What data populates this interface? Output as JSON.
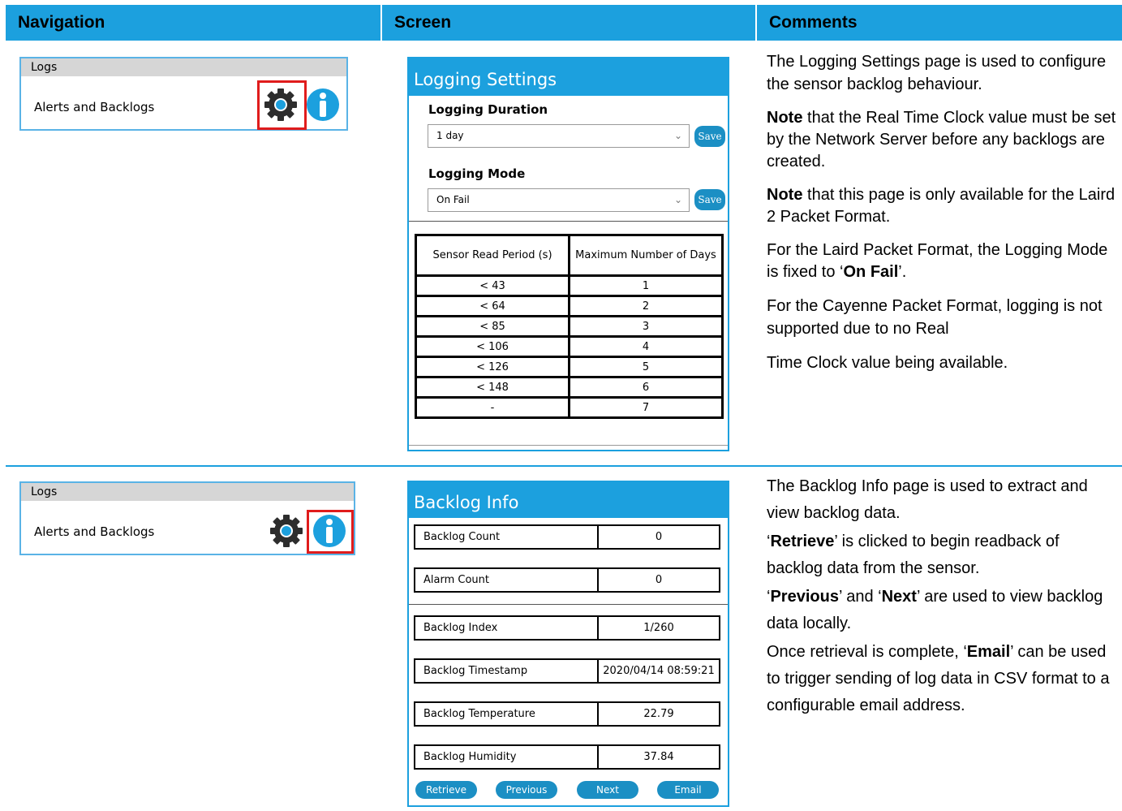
{
  "header": {
    "navigation": "Navigation",
    "screen": "Screen",
    "comments": "Comments"
  },
  "row1": {
    "nav": {
      "bar": "Logs",
      "item": "Alerts and Backlogs",
      "icons": [
        "gear-icon",
        "info-icon"
      ],
      "highlighted": "gear-icon"
    },
    "screen": {
      "title": "Logging Settings",
      "duration_label": "Logging Duration",
      "duration_value": "1 day",
      "mode_label": "Logging Mode",
      "mode_value": "On Fail",
      "save": "Save",
      "table": {
        "headers": [
          "Sensor Read Period (s)",
          "Maximum Number of Days"
        ],
        "rows": [
          [
            "< 43",
            "1"
          ],
          [
            "< 64",
            "2"
          ],
          [
            "< 85",
            "3"
          ],
          [
            "< 106",
            "4"
          ],
          [
            "< 126",
            "5"
          ],
          [
            "< 148",
            "6"
          ],
          [
            "-",
            "7"
          ]
        ]
      }
    },
    "comments": {
      "p1": "The Logging Settings page is used to configure the sensor backlog behaviour.",
      "note": "Note",
      "p2": " that the Real Time Clock value must be set by the Network Server before any backlogs are created.",
      "p3": " that this page is only available for the Laird 2 Packet Format.",
      "p4a": "For the Laird Packet Format, the Logging Mode is fixed to ‘",
      "p4b": "On Fail",
      "p4c": "’.",
      "p5": "For the Cayenne Packet Format, logging is not supported due to no Real",
      "p6": "Time Clock value being available."
    }
  },
  "row2": {
    "nav": {
      "bar": "Logs",
      "item": "Alerts and Backlogs",
      "icons": [
        "gear-icon",
        "info-icon"
      ],
      "highlighted": "info-icon"
    },
    "screen": {
      "title": "Backlog Info",
      "fields": [
        {
          "label": "Backlog Count",
          "value": "0"
        },
        {
          "label": "Alarm Count",
          "value": "0"
        },
        {
          "label": "Backlog Index",
          "value": "1/260"
        },
        {
          "label": "Backlog Timestamp",
          "value": "2020/04/14 08:59:21"
        },
        {
          "label": "Backlog Temperature",
          "value": "22.79"
        },
        {
          "label": "Backlog Humidity",
          "value": "37.84"
        }
      ],
      "buttons": [
        "Retrieve",
        "Previous",
        "Next",
        "Email"
      ]
    },
    "comments": {
      "p1": "The Backlog Info page is used to extract and view backlog data.",
      "q1": "‘",
      "retrieve": "Retrieve",
      "p2": "’ is clicked to begin readback of backlog data from the sensor.",
      "previous": "Previous",
      "and": "’ and ‘",
      "next": "Next",
      "p3": "’ are used to view backlog data locally.",
      "p4a": "Once retrieval is complete, ‘",
      "email": "Email",
      "p4b": "’ can be used to trigger sending of log data in CSV format to a configurable email address."
    }
  },
  "colors": {
    "accent": "#1ca0de",
    "button": "#1b8fc4",
    "highlight": "#e01c1c",
    "nav_bar": "#d6d6d6"
  }
}
